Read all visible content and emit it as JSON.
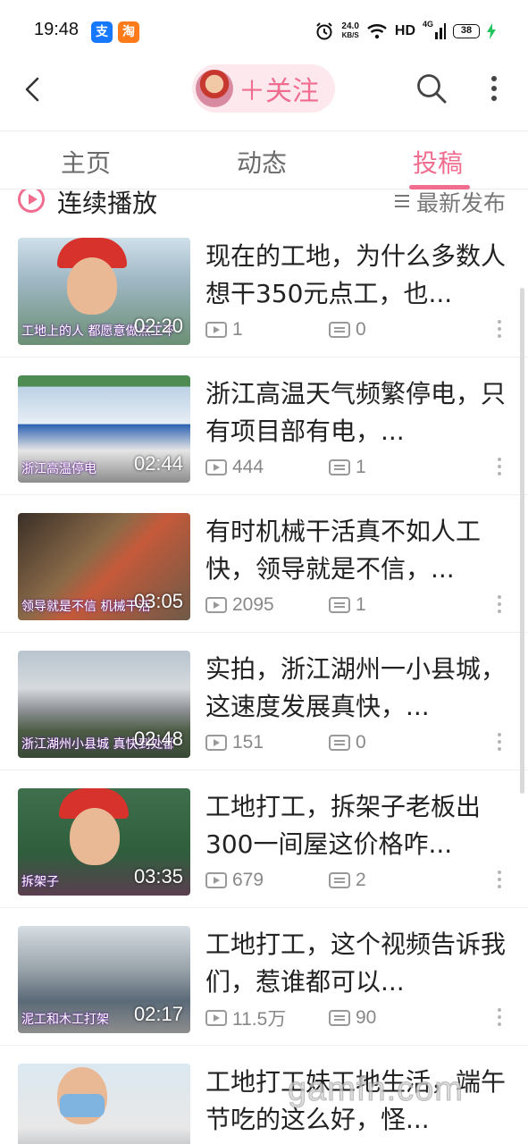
{
  "status_bar": {
    "time": "19:48",
    "app_icons": [
      "alipay-icon",
      "taobao-icon"
    ],
    "speed_value": "24.0",
    "speed_unit": "KB/S",
    "network": "HD",
    "cellular": "4G",
    "battery": "38",
    "charging": true
  },
  "nav": {
    "follow_label": "＋关注",
    "back_icon": "back-arrow-icon",
    "search_icon": "search-icon",
    "more_icon": "more-vertical-icon"
  },
  "tabs": [
    {
      "label": "主页",
      "active": false
    },
    {
      "label": "动态",
      "active": false
    },
    {
      "label": "投稿",
      "active": true
    }
  ],
  "subheader": {
    "continuous_play": "连续播放",
    "sort_label": "最新发布"
  },
  "videos": [
    {
      "title": "现在的工地，为什么多数人想干350元点工，也...",
      "duration": "02:20",
      "caption": "工地上的人 都愿意做点工不",
      "plays": "1",
      "comments": "0"
    },
    {
      "title": "浙江高温天气频繁停电，只有项目部有电，...",
      "duration": "02:44",
      "caption": "浙江高温停电",
      "plays": "444",
      "comments": "1"
    },
    {
      "title": "有时机械干活真不如人工快，领导就是不信，...",
      "duration": "03:05",
      "caption": "领导就是不信 机械干活",
      "plays": "2095",
      "comments": "1"
    },
    {
      "title": "实拍，浙江湖州一小县城，这速度发展真快，...",
      "duration": "02:48",
      "caption": "浙江湖州小县城 真快到处都",
      "plays": "151",
      "comments": "0"
    },
    {
      "title": "工地打工，拆架子老板出300一间屋这价格咋...",
      "duration": "03:35",
      "caption": "拆架子",
      "plays": "679",
      "comments": "2"
    },
    {
      "title": "工地打工，这个视频告诉我们，惹谁都可以...",
      "duration": "02:17",
      "caption": "泥工和木工打架",
      "plays": "11.5万",
      "comments": "90"
    },
    {
      "title": "工地打工妹工地生活，端午节吃的这么好，怪...",
      "duration": "",
      "caption": "",
      "plays": "",
      "comments": ""
    }
  ],
  "watermark": "gamfn.com",
  "colors": {
    "accent": "#f06d8f",
    "follow_bg": "#fde8ee",
    "alipay": "#1677ff",
    "taobao": "#ff7a1a",
    "charging": "#22c55e"
  }
}
